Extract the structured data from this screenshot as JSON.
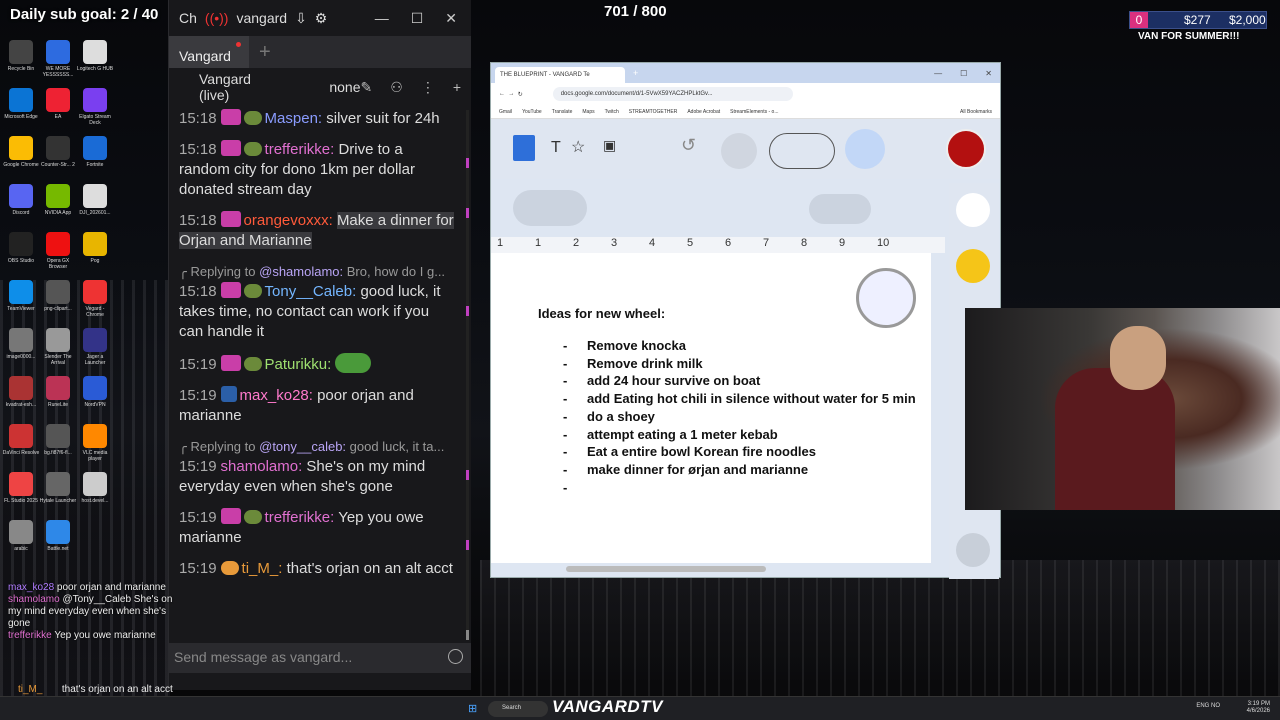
{
  "overlay": {
    "sub_goal": "Daily sub goal: 2 / 40",
    "counter": "701 / 800",
    "donation_badge": "0",
    "donation_amount": "$277",
    "donation_goal": "$2,000",
    "donation_title": "VAN FOR SUMMER!!!"
  },
  "desktop_icons": [
    "Recycle Bin",
    "WE MORE YESSSSSS...",
    "Logitech G HUB",
    "Microsoft Edge",
    "EA",
    "Elgato Stream Deck",
    "Google Chrome",
    "Counter-Str... 2",
    "Fortnite",
    "Discord",
    "NVIDIA App",
    "DJI_202601...",
    "OBS Studio",
    "Opera GX Browser",
    "Pog",
    "TeamViewer",
    "png-clipart...",
    "Vegard - Chrome",
    "image0000...",
    "Slender The Arrival",
    "Jager a Launcher",
    "kvadrat-esh...",
    "RuneLite",
    "NordVPN",
    "DaVinci Resolve",
    "bg.fi87f6-fl...",
    "VLC media player",
    "FL Studio 2025",
    "Hytale Launcher",
    "host.devel...",
    "arabic",
    "Battle.net"
  ],
  "chat": {
    "title_short": "Ch",
    "title_user": "vangard",
    "tab": "Vangard",
    "channel": "Vangard (live)",
    "mode": "none",
    "placeholder": "Send message as vangard...",
    "messages": [
      {
        "time": "15:18",
        "user": "Maspen:",
        "text": "silver suit for 24h"
      },
      {
        "time": "15:18",
        "user": "trefferikke:",
        "text": "Drive to a random city for dono 1km per dollar donated stream day"
      },
      {
        "time": "15:18",
        "user": "orangevoxxx:",
        "text": "Make a dinner for Orjan and Marianne"
      },
      {
        "reply_prefix": "Replying to",
        "reply_user": "@shamolamo:",
        "reply_text": "Bro, how do I g...",
        "time": "15:18",
        "user": "Tony__Caleb:",
        "text": "good luck, it takes time, no contact can work if you can handle it"
      },
      {
        "time": "15:19",
        "user": "Paturikku:",
        "text": ""
      },
      {
        "time": "15:19",
        "user": "max_ko28:",
        "text": "poor orjan and marianne"
      },
      {
        "reply_prefix": "Replying to",
        "reply_user": "@tony__caleb:",
        "reply_text": "good luck, it ta...",
        "time": "15:19",
        "user": "shamolamo:",
        "text": "She's on my mind everyday even when she's gone"
      },
      {
        "time": "15:19",
        "user": "trefferikke:",
        "text": "Yep you owe marianne"
      },
      {
        "time": "15:19",
        "user": "ti_M_:",
        "text": "that's orjan on an alt acct"
      }
    ]
  },
  "ghost_chat": [
    {
      "user": "max_ko28",
      "text": "poor orjan and marianne"
    },
    {
      "user": "shamolamo",
      "text": "@Tony__Caleb She's on my mind everyday even when she's gone"
    },
    {
      "user": "trefferikke",
      "text": "Yep you owe marianne"
    },
    {
      "user": "ti_M_",
      "text": "that's orjan on an alt acct"
    }
  ],
  "browser": {
    "tab_title": "THE BLUEPRINT - VANGARD Te",
    "url": "docs.google.com/document/d/1-5VwX59YACZHPLktGv...",
    "bookmarks": [
      "Gmail",
      "YouTube",
      "Translate",
      "Maps",
      "Twitch",
      "STREAMTOGETHER",
      "Adobe Acrobat",
      "StreamElements - o...",
      "All Bookmarks"
    ],
    "ruler": [
      "1",
      "1",
      "2",
      "3",
      "4",
      "5",
      "6",
      "7",
      "8",
      "9",
      "10"
    ],
    "doc_heading": "Ideas for new wheel:",
    "doc_items": [
      "Remove knocka",
      "Remove drink milk",
      "add 24 hour survive on boat",
      "add Eating hot chili in silence without water for 5 min",
      "do a shoey",
      "attempt eating a 1 meter kebab",
      "Eat a entire bowl Korean fire noodles",
      "make dinner for ørjan and marianne",
      ""
    ]
  },
  "taskbar": {
    "search": "Search",
    "brand": "VANGARDTV",
    "lang": "ENG NO",
    "time": "3:19 PM",
    "date": "4/6/2026"
  }
}
